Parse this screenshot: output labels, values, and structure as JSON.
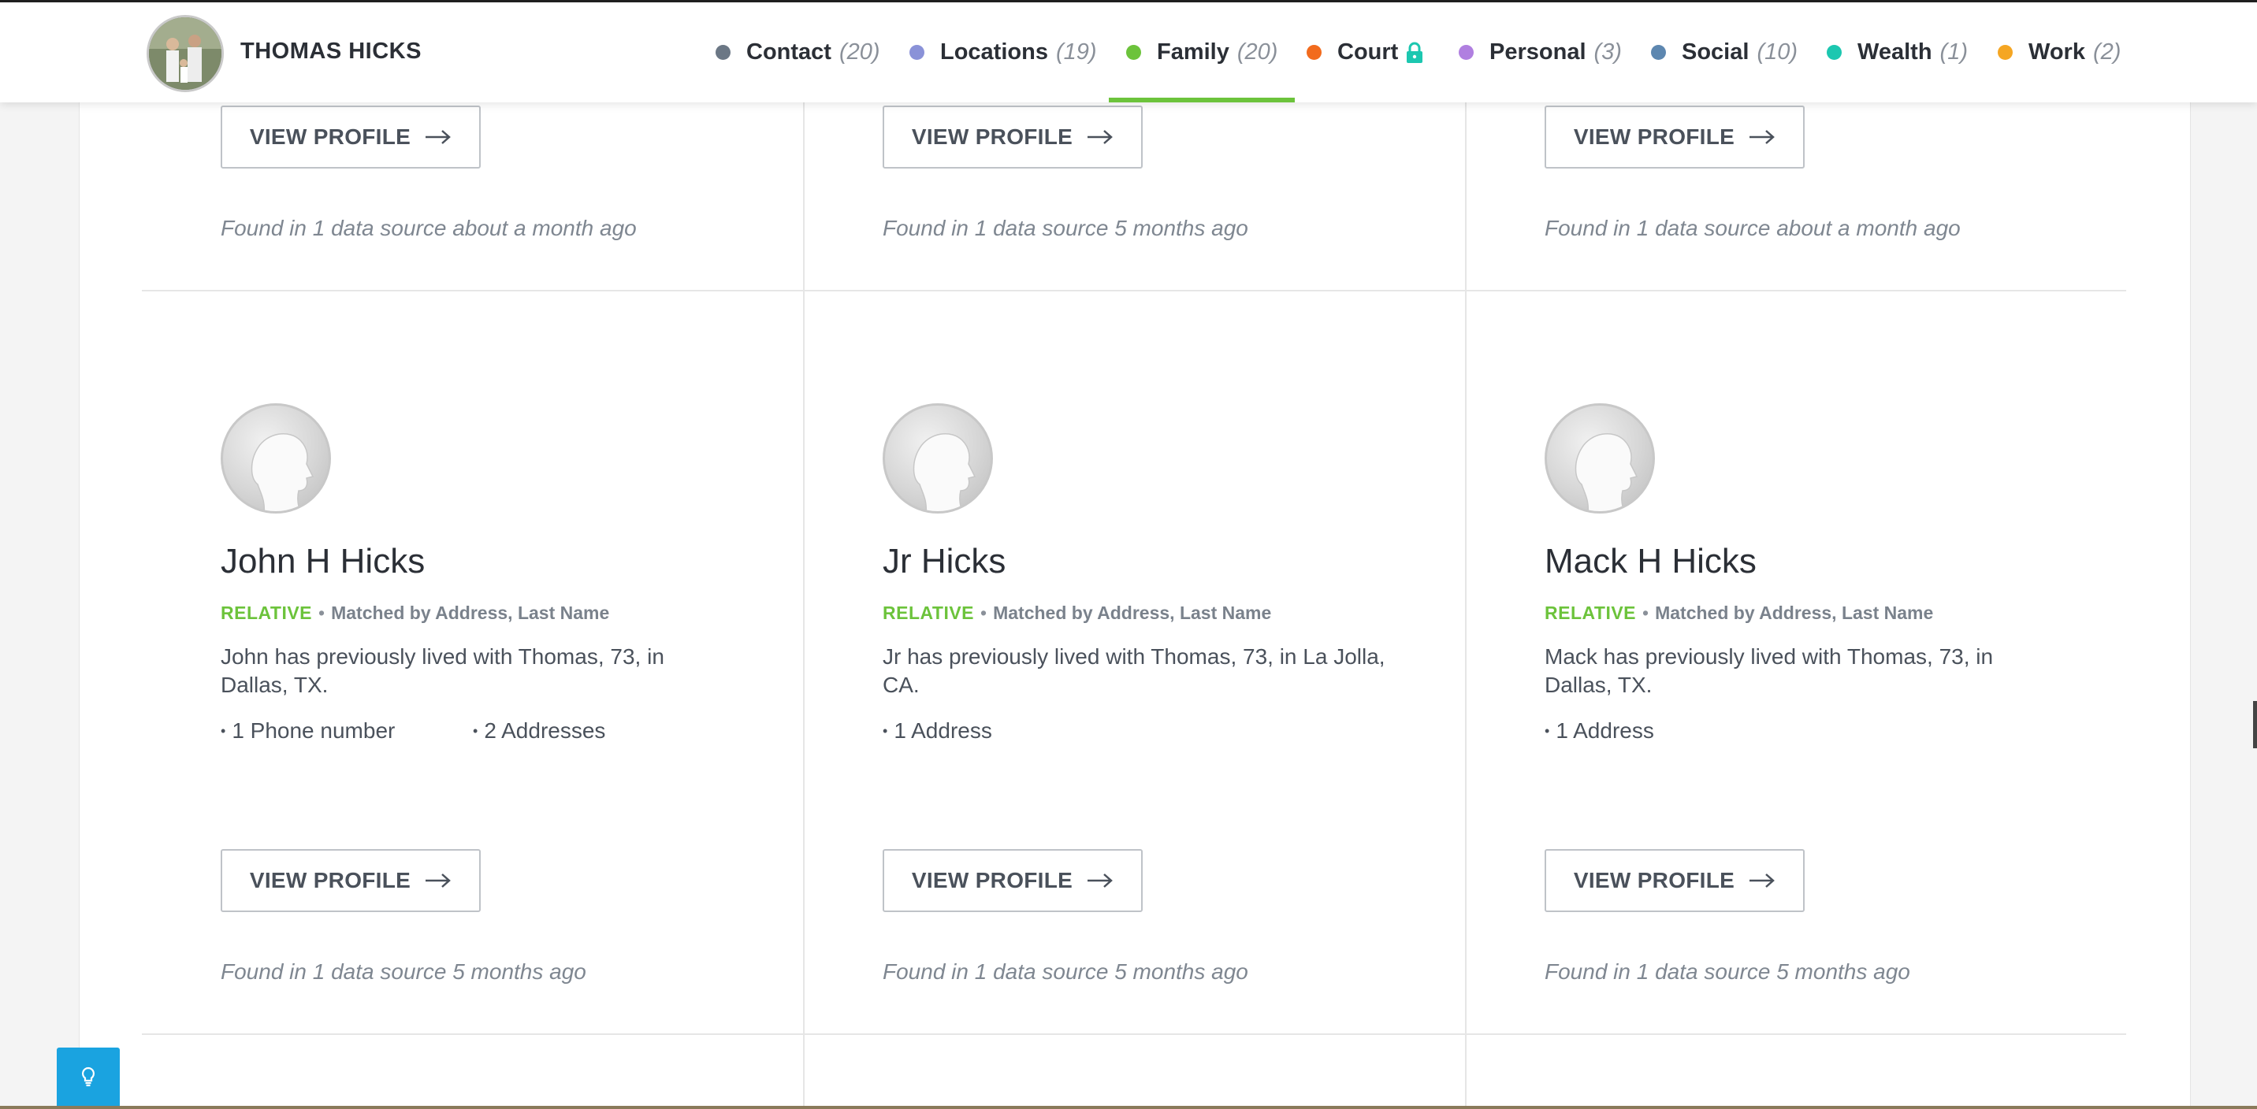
{
  "header": {
    "name": "THOMAS HICKS",
    "nav": [
      {
        "label": "Contact",
        "count": "(20)",
        "color": "#6b7785",
        "active": false
      },
      {
        "label": "Locations",
        "count": "(19)",
        "color": "#8a92d8",
        "active": false
      },
      {
        "label": "Family",
        "count": "(20)",
        "color": "#6cc33b",
        "active": true
      },
      {
        "label": "Court",
        "count": "",
        "color": "#f26b1d",
        "active": false,
        "icon": "lock-icon"
      },
      {
        "label": "Personal",
        "count": "(3)",
        "color": "#b07fe0",
        "active": false
      },
      {
        "label": "Social",
        "count": "(10)",
        "color": "#5d87b0",
        "active": false
      },
      {
        "label": "Wealth",
        "count": "(1)",
        "color": "#1cc7b0",
        "active": false
      },
      {
        "label": "Work",
        "count": "(2)",
        "color": "#f5a623",
        "active": false
      }
    ]
  },
  "top_row": [
    {
      "button": "VIEW PROFILE",
      "found": "Found in 1 data source about a month ago"
    },
    {
      "button": "VIEW PROFILE",
      "found": "Found in 1 data source 5 months ago"
    },
    {
      "button": "VIEW PROFILE",
      "found": "Found in 1 data source about a month ago"
    }
  ],
  "cards": [
    {
      "name": "John H Hicks",
      "relation": "RELATIVE",
      "match": "Matched by Address, Last Name",
      "description": "John has previously lived with Thomas, 73, in Dallas, TX.",
      "facts": [
        "1 Phone number",
        "2 Addresses"
      ],
      "button": "VIEW PROFILE",
      "found": "Found in 1 data source 5 months ago"
    },
    {
      "name": "Jr Hicks",
      "relation": "RELATIVE",
      "match": "Matched by Address, Last Name",
      "description": "Jr has previously lived with Thomas, 73, in La Jolla, CA.",
      "facts": [
        "1 Address"
      ],
      "button": "VIEW PROFILE",
      "found": "Found in 1 data source 5 months ago"
    },
    {
      "name": "Mack H Hicks",
      "relation": "RELATIVE",
      "match": "Matched by Address, Last Name",
      "description": "Mack has previously lived with Thomas, 73, in Dallas, TX.",
      "facts": [
        "1 Address"
      ],
      "button": "VIEW PROFILE",
      "found": "Found in 1 data source 5 months ago"
    }
  ],
  "help": {
    "icon": "lightbulb-icon"
  }
}
